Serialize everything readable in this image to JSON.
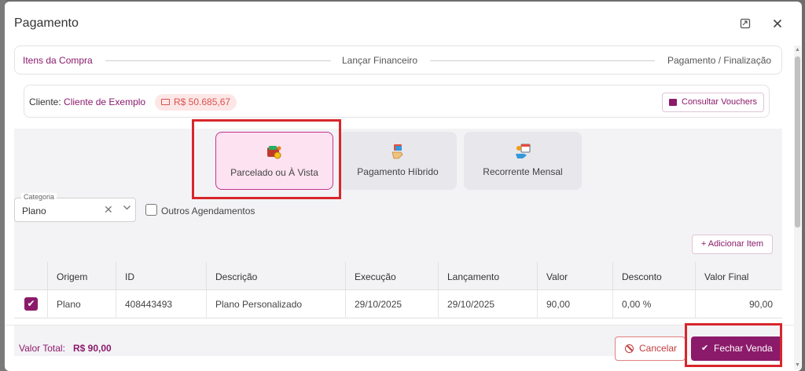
{
  "dialog": {
    "title": "Pagamento"
  },
  "stepper": {
    "steps": [
      {
        "label": "Itens da Compra",
        "active": true
      },
      {
        "label": "Lançar Financeiro",
        "active": false
      },
      {
        "label": "Pagamento / Finalização",
        "active": false
      }
    ]
  },
  "client": {
    "label": "Cliente:",
    "name": "Cliente de Exemplo",
    "balance": "R$ 50.685,67",
    "vouchers_button": "Consultar Vouchers"
  },
  "payment_options": [
    {
      "label": "Parcelado ou À Vista",
      "selected": true,
      "icon": "wallet-icon"
    },
    {
      "label": "Pagamento Híbrido",
      "selected": false,
      "icon": "hand-cards-icon"
    },
    {
      "label": "Recorrente Mensal",
      "selected": false,
      "icon": "hand-calendar-icon"
    }
  ],
  "filters": {
    "category_legend": "Categoria",
    "category_value": "Plano",
    "other_schedules_label": "Outros Agendamentos",
    "other_schedules_checked": false
  },
  "table": {
    "add_item_button": "+ Adicionar Item",
    "headers": [
      "Origem",
      "ID",
      "Descrição",
      "Execução",
      "Lançamento",
      "Valor",
      "Desconto",
      "Valor Final"
    ],
    "rows": [
      {
        "checked": true,
        "cells": [
          "Plano",
          "408443493",
          "Plano Personalizado",
          "29/10/2025",
          "29/10/2025",
          "90,00",
          "0,00 %",
          "90,00"
        ]
      }
    ]
  },
  "footer": {
    "total_label": "Valor Total:",
    "total_value": "R$ 90,00",
    "cancel_button": "Cancelar",
    "close_sale_button": "Fechar Venda"
  },
  "colors": {
    "primary": "#8b1a6b",
    "highlight": "#d8262c",
    "selected_bg": "#fde2f1",
    "danger": "#c23b3b"
  }
}
